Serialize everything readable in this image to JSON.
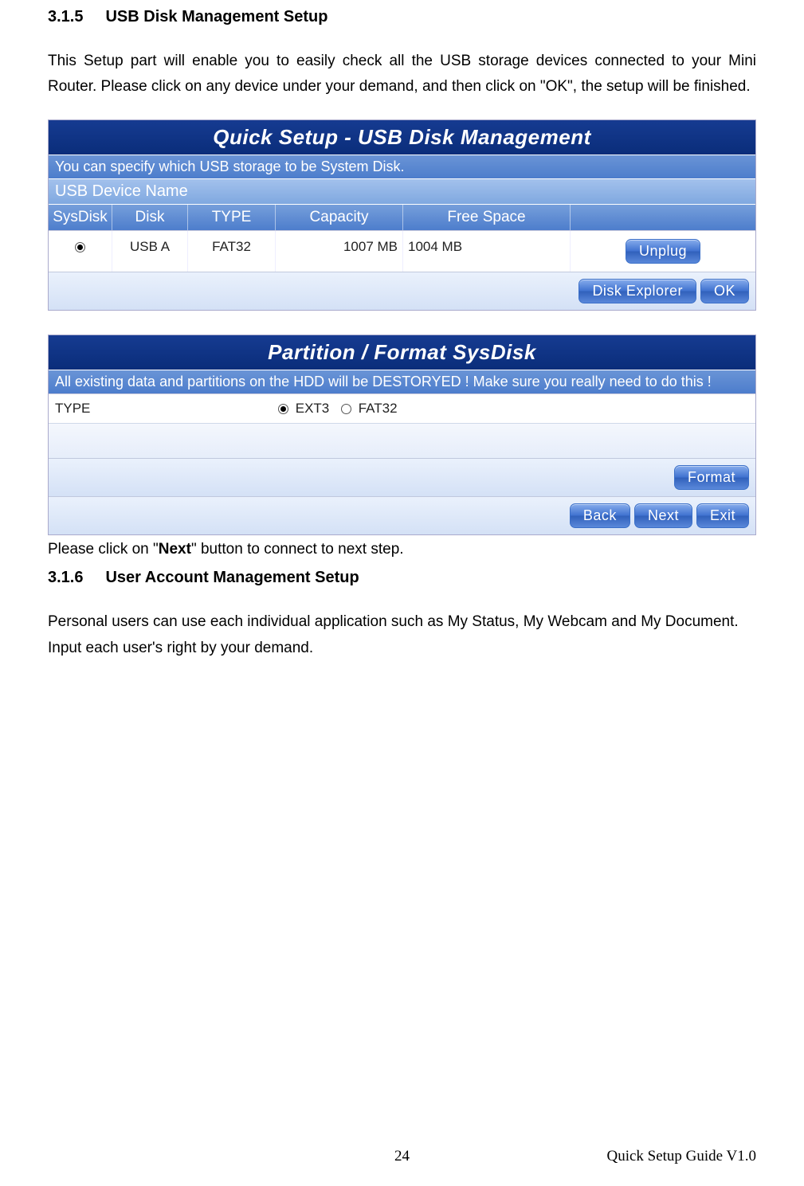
{
  "section315": {
    "num": "3.1.5",
    "title": "USB Disk Management Setup",
    "para": "This Setup part will enable you to easily check all the USB storage devices connected to your Mini Router. Please click on any device under your demand, and then click on \"OK\", the setup will be finished."
  },
  "usb_panel": {
    "title": "Quick Setup - USB Disk Management",
    "subtitle": "You can specify which USB storage to be System Disk.",
    "device_header": "USB Device Name",
    "columns": {
      "sysdisk": "SysDisk",
      "disk": "Disk",
      "type": "TYPE",
      "capacity": "Capacity",
      "free": "Free Space"
    },
    "row": {
      "disk": "USB A",
      "type": "FAT32",
      "capacity": "1007 MB",
      "free": "1004 MB"
    },
    "buttons": {
      "unplug": "Unplug",
      "disk_explorer": "Disk Explorer",
      "ok": "OK"
    }
  },
  "part_panel": {
    "title": "Partition / Format SysDisk",
    "warn": "All existing data and partitions on the HDD will be DESTORYED ! Make sure you really need to do this !",
    "type_label": "TYPE",
    "ext3": "EXT3",
    "fat32": "FAT32",
    "buttons": {
      "format": "Format",
      "back": "Back",
      "next": "Next",
      "exit": "Exit"
    }
  },
  "after_panel": {
    "text_pre": "Please click on \"",
    "next_word": "Next",
    "text_post": "\" button to connect to next step."
  },
  "section316": {
    "num": "3.1.6",
    "title": "User Account Management Setup",
    "para": "Personal users can use each individual application such as My Status, My Webcam and My Document. Input each user's right by your demand."
  },
  "footer": {
    "page": "24",
    "guide": "Quick Setup Guide V1.0"
  }
}
